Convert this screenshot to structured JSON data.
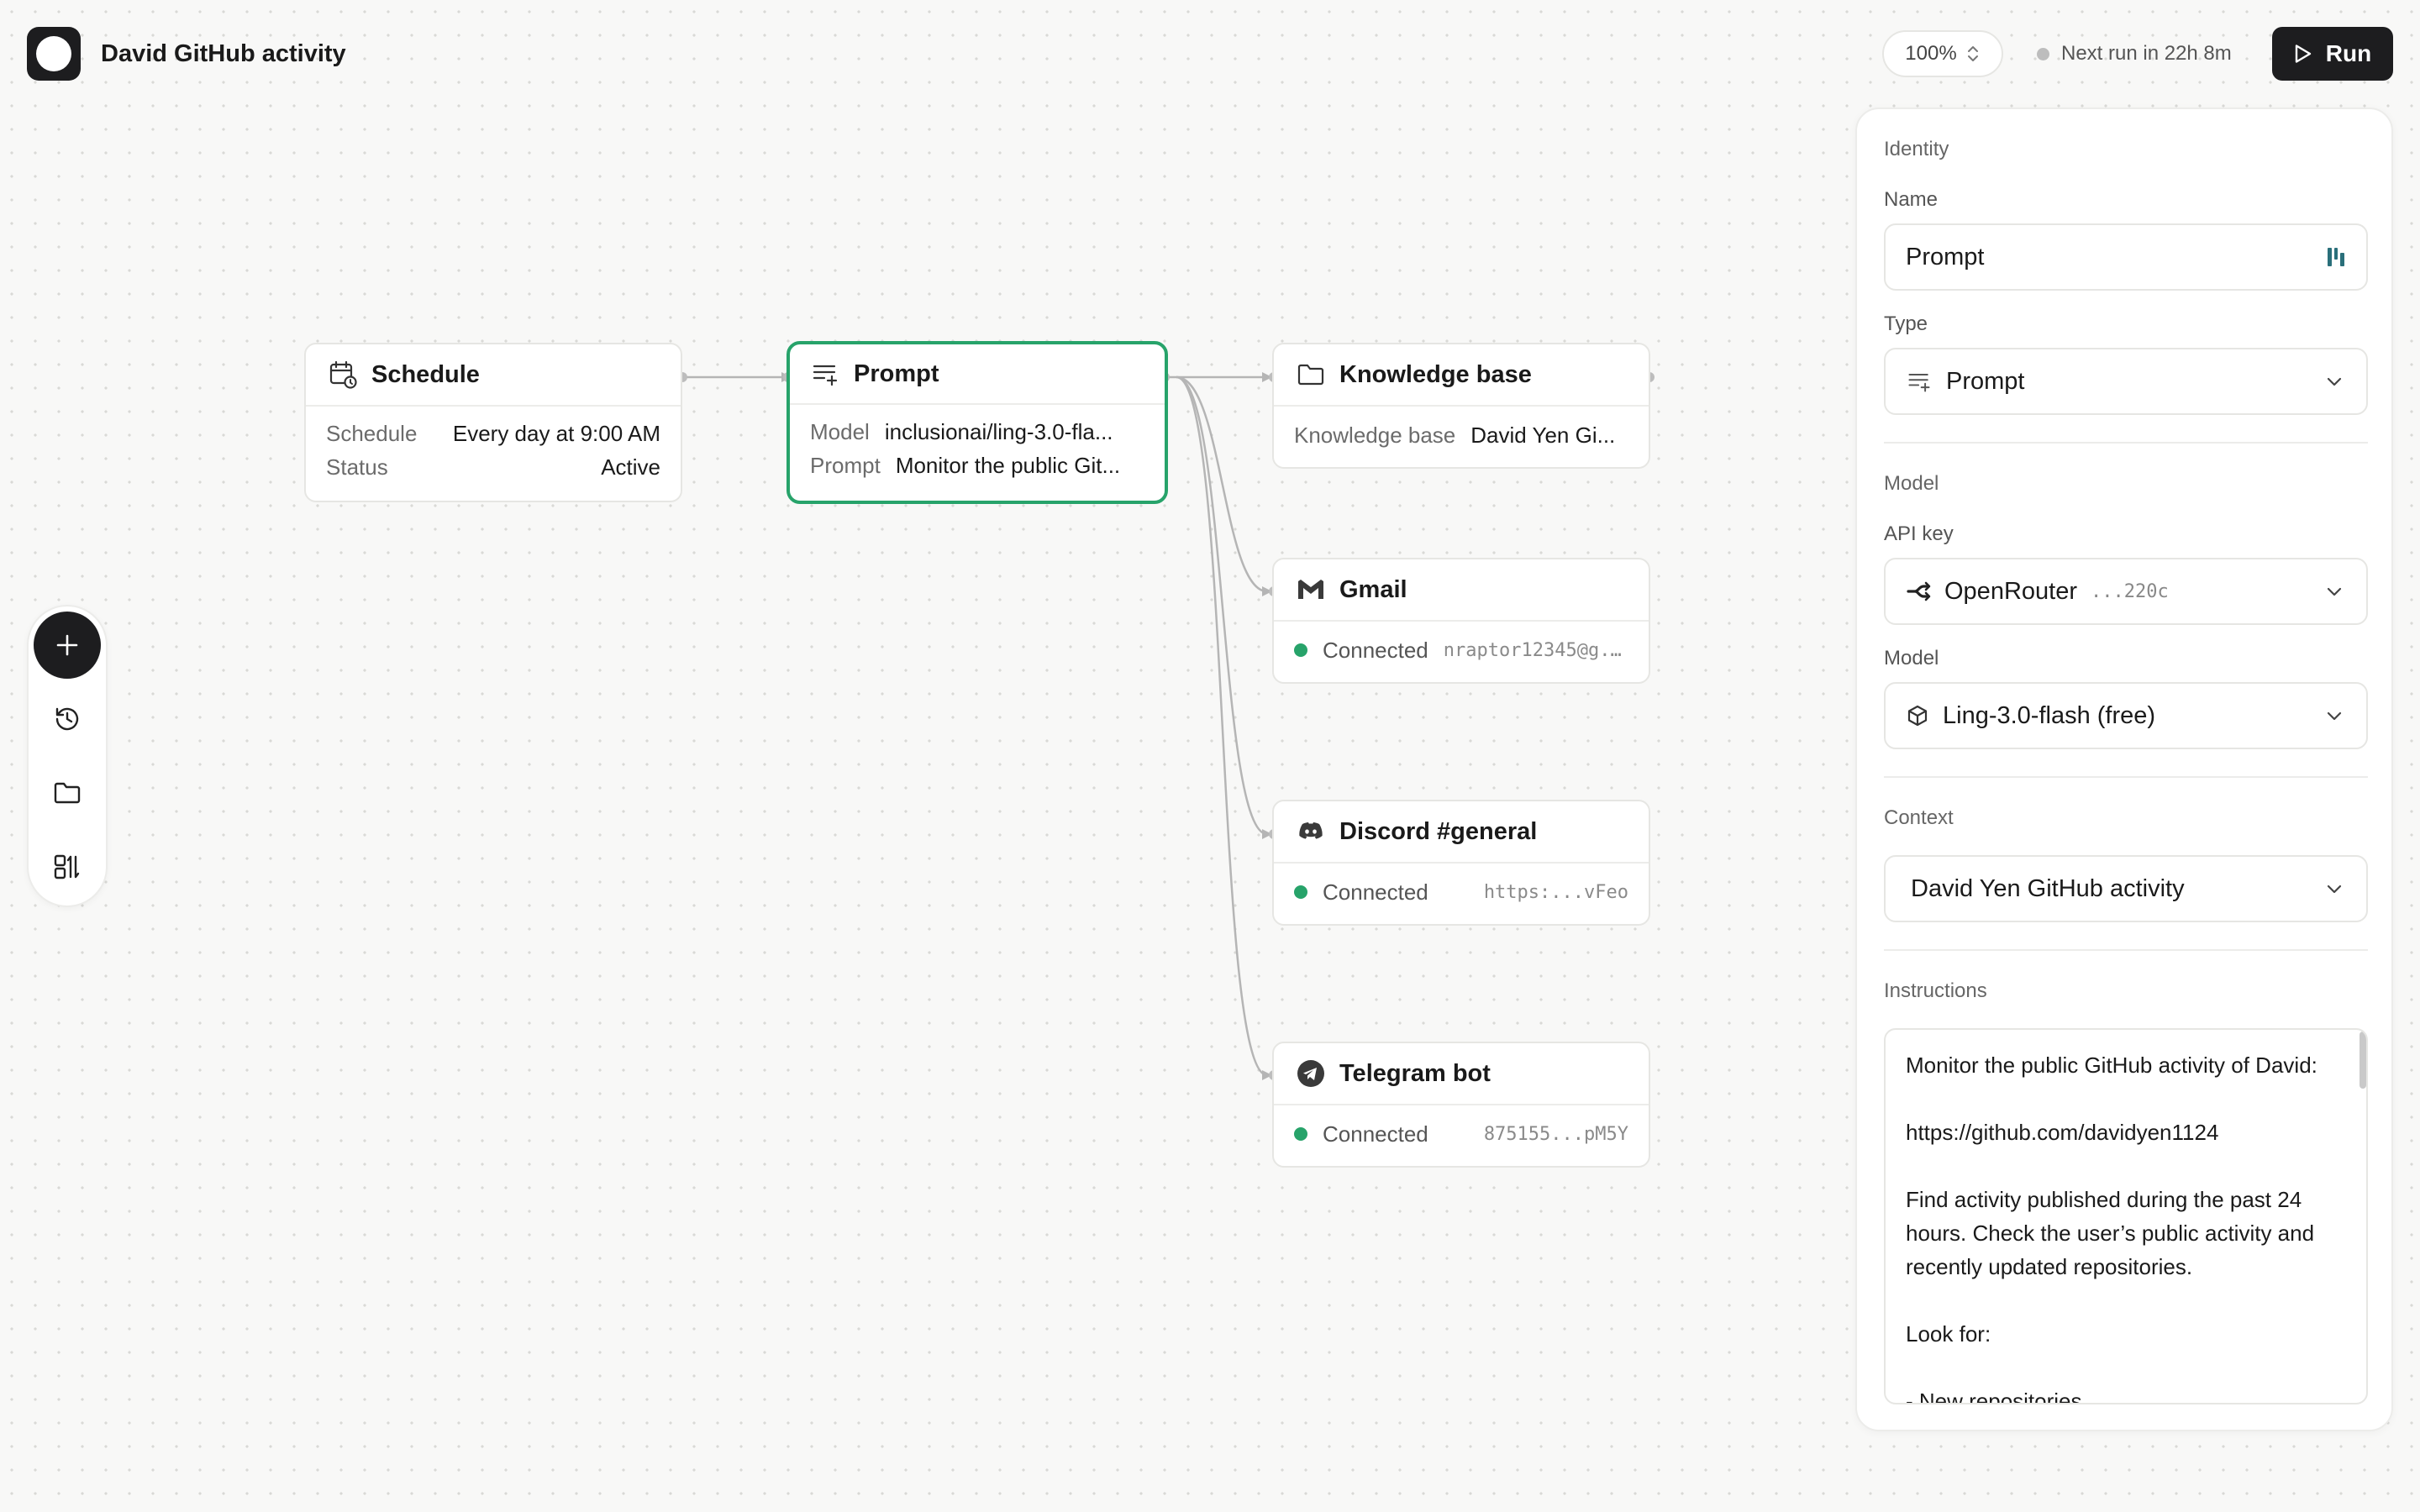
{
  "header": {
    "title": "David GitHub activity",
    "zoom": "100%",
    "next_run": "Next run in 22h 8m",
    "run_label": "Run"
  },
  "nodes": {
    "schedule": {
      "title": "Schedule",
      "rows": [
        {
          "key": "Schedule",
          "value": "Every day at 9:00 AM"
        },
        {
          "key": "Status",
          "value": "Active"
        }
      ]
    },
    "prompt": {
      "title": "Prompt",
      "rows": [
        {
          "key": "Model",
          "value": "inclusionai/ling-3.0-fla..."
        },
        {
          "key": "Prompt",
          "value": "Monitor the public Git..."
        }
      ]
    },
    "knowledge": {
      "title": "Knowledge base",
      "rows": [
        {
          "key": "Knowledge base",
          "value": "David Yen Gi..."
        }
      ]
    },
    "gmail": {
      "title": "Gmail",
      "status": "Connected",
      "detail": "nraptor12345@g..."
    },
    "discord": {
      "title": "Discord #general",
      "status": "Connected",
      "detail": "https:...vFeo"
    },
    "telegram": {
      "title": "Telegram bot",
      "status": "Connected",
      "detail": "875155...pM5Y"
    }
  },
  "panel": {
    "identity_label": "Identity",
    "name_label": "Name",
    "name_value": "Prompt",
    "type_label": "Type",
    "type_value": "Prompt",
    "model_section": "Model",
    "api_key_label": "API key",
    "api_key_provider": "OpenRouter",
    "api_key_suffix": "...220c",
    "model_label": "Model",
    "model_value": "Ling-3.0-flash (free)",
    "context_section": "Context",
    "context_value": "David Yen GitHub activity",
    "instructions_label": "Instructions",
    "instructions_text": "Monitor the public GitHub activity of David:\n\nhttps://github.com/davidyen1124\n\nFind activity published during the past 24 hours. Check the user’s public activity and recently updated repositories.\n\nLook for:\n\n- New repositories"
  },
  "colors": {
    "accent_green": "#27a36a",
    "dark": "#1d1d1f",
    "background": "#f8f8f7"
  },
  "icons": {
    "schedule": "calendar-clock-icon",
    "prompt": "list-plus-icon",
    "knowledge": "folder-icon",
    "gmail": "gmail-icon",
    "discord": "discord-icon",
    "telegram": "telegram-icon"
  }
}
